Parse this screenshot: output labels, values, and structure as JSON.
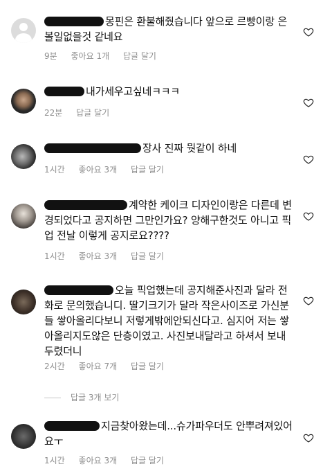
{
  "comments": [
    {
      "text": "몽핀은 환불해줬습니다 앞으로 르빵이랑 은 볼일없을것 같네요",
      "time": "9분",
      "likes": "좋아요 1개",
      "reply": "답글 달기"
    },
    {
      "text": "내가세우고싶네ㅋㅋㅋ",
      "time": "22분",
      "likes": "",
      "reply": "답글 달기"
    },
    {
      "text": "장사 진짜 뭣같이 하네",
      "time": "1시간",
      "likes": "좋아요 3개",
      "reply": "답글 달기"
    },
    {
      "text": "계약한 케이크 디자인이랑은 다른데 변경되었다고 공지하면 그만인가요? 양해구한것도 아니고 픽업 전날 이렇게 공지로요????",
      "time": "1시간",
      "likes": "좋아요 3개",
      "reply": "답글 달기"
    },
    {
      "text": "오늘 픽업했는데 공지해준사진과 달라 전화로 문의했습니디. 딸기크기가 달라 작은사이즈로 가신분들 쌓아올리다보니 저렇게밖에안되신다고. 심지어 저는 쌓아올리지도않은 단층이였고. 사진보내달라고 하셔서 보내두렸더니",
      "time": "2시간",
      "likes": "좋아요 7개",
      "reply": "답글 달기"
    },
    {
      "text": "지금찾아왔는데...슈가파우더도 안뿌려져있어요ㅜ",
      "time": "1시간",
      "likes": "좋아요 3개",
      "reply": "답글 달기"
    }
  ],
  "view_replies": "답글 3개 보기",
  "icons": {
    "heart": "heart-outline-icon",
    "avatar": "default-avatar-icon"
  },
  "colors": {
    "meta": "#8e8e8e",
    "text": "#111111",
    "heart": "#262626"
  }
}
